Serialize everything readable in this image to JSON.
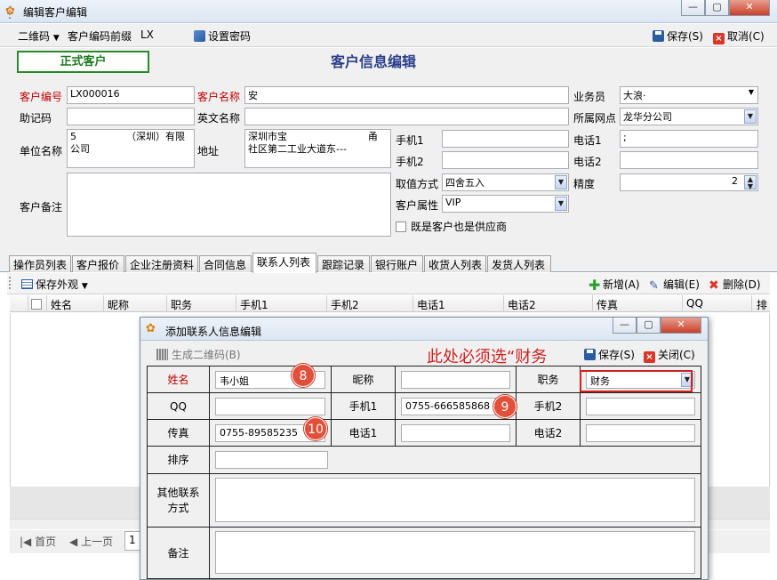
{
  "window": {
    "title": "编辑客户编辑",
    "buttons": {
      "minimize": "—",
      "maximize": "▢",
      "close": "✕"
    }
  },
  "toolbar": {
    "qr_label": "二维码",
    "prefix_label": "客户编码前缀",
    "prefix_value": "LX",
    "set_password": "设置密码",
    "save": "保存(S)",
    "cancel": "取消(C)"
  },
  "form": {
    "customer_type": "正式客户",
    "title": "客户信息编辑",
    "labels": {
      "code": "客户编号",
      "name": "客户名称",
      "salesman": "业务员",
      "mnemonic": "助记码",
      "english_name": "英文名称",
      "branch": "所属网点",
      "company": "单位名称",
      "address": "地址",
      "mobile1": "手机1",
      "phone1": "电话1",
      "mobile2": "手机2",
      "phone2": "电话2",
      "rounding": "取值方式",
      "precision": "精度",
      "remark": "客户备注",
      "attribute": "客户属性",
      "supplier": "既是客户也是供应商"
    },
    "values": {
      "code": "LX000016",
      "name": "安",
      "salesman": "大浪·",
      "mnemonic": "",
      "english_name": "",
      "branch": "龙华分公司",
      "company_line1": "5                （深圳）有限",
      "company_line2": "公司",
      "address_line1": "深圳市宝                          甬",
      "address_line2": "社区第二工业大道东---",
      "mobile1": "",
      "phone1": ";",
      "mobile2": "",
      "phone2": "",
      "rounding": "四舍五入",
      "precision": "2",
      "attribute": "VIP",
      "remark": ""
    }
  },
  "tabs": [
    "操作员列表",
    "客户报价",
    "企业注册资料",
    "合同信息",
    "联系人列表",
    "跟踪记录",
    "银行账户",
    "收货人列表",
    "发货人列表"
  ],
  "tab_toolbar": {
    "save_view": "保存外观",
    "add": "新增(A)",
    "edit": "编辑(E)",
    "delete": "删除(D)"
  },
  "grid_columns": [
    "姓名",
    "昵称",
    "职务",
    "手机1",
    "手机2",
    "电话1",
    "电话2",
    "传真",
    "QQ",
    "排"
  ],
  "pager": {
    "first": "首页",
    "prev": "上一页",
    "page": "1"
  },
  "dialog": {
    "title": "添加联系人信息编辑",
    "gen_qr": "生成二维码(B)",
    "save": "保存(S)",
    "close": "关闭(C)",
    "annotation": "此处必须选“财务",
    "labels": {
      "name": "姓名",
      "nickname": "昵称",
      "post": "职务",
      "qq": "QQ",
      "mobile1": "手机1",
      "mobile2": "手机2",
      "fax": "传真",
      "phone1": "电话1",
      "phone2": "电话2",
      "sort": "排序",
      "other": "其他联系方式",
      "remark": "备注"
    },
    "values": {
      "name": "韦小姐",
      "nickname": "",
      "post": "财务",
      "qq": "",
      "mobile1": "0755-666585868",
      "mobile2": "",
      "fax": "0755-89585235",
      "phone1": "",
      "phone2": "",
      "sort": "",
      "other": "",
      "remark": ""
    },
    "badges": [
      "8",
      "9",
      "10"
    ]
  },
  "colors": {
    "accent_blue": "#2b3f8a",
    "required_red": "#c00000",
    "annotation_red": "#d02020",
    "badge_red": "#e0503a",
    "type_green": "#2a8a2a"
  }
}
